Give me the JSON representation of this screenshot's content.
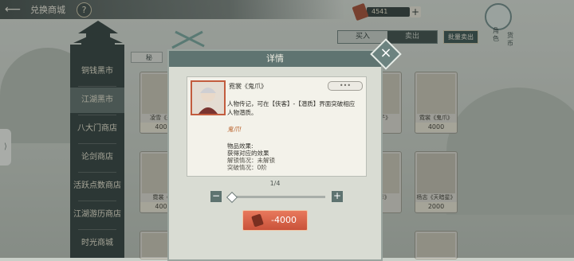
{
  "header": {
    "title": "兑换商城",
    "help_label": "?",
    "back_icon": "back-arrow-icon"
  },
  "currency": {
    "amount": "4541",
    "plus_label": "+",
    "icon": "token-icon"
  },
  "side_tab": {
    "line1": "角色",
    "line2": "货币"
  },
  "tabs": [
    {
      "label": "买入",
      "active": true
    },
    {
      "label": "卖出",
      "active": false
    }
  ],
  "batch_sell_label": "批量卖出",
  "filter_label": "秘",
  "sidebar": {
    "items": [
      {
        "label": "铜钱黑市",
        "active": false
      },
      {
        "label": "江湖黑市",
        "active": true
      },
      {
        "label": "八大门商店",
        "active": false
      },
      {
        "label": "论剑商店",
        "active": false
      },
      {
        "label": "活跃点数商店",
        "active": false
      },
      {
        "label": "江湖游历商店",
        "active": false
      },
      {
        "label": "时光商城",
        "active": false
      }
    ]
  },
  "cards": {
    "row1": [
      {
        "name": "凌雪《天",
        "price": "400"
      },
      {
        "name": "",
        "price": ""
      },
      {
        "name": "(摔)子》",
        "price": ""
      },
      {
        "name": "霓裳《鬼爪》",
        "price": "4000"
      }
    ],
    "row2": [
      {
        "name": "霓裳《",
        "price": "400"
      },
      {
        "name": "",
        "price": ""
      },
      {
        "name": "(刀影》",
        "price": ""
      },
      {
        "name": "杨志《天暗星》",
        "price": "2000"
      }
    ]
  },
  "dialog": {
    "title": "详情",
    "item_name": "霓裳《鬼爪》",
    "more_label": "•••",
    "description": "人物传记，可在【侠客】-【潜质】界面突破相应人物潜质。",
    "quote": "鬼爪!",
    "effect_title": "物品效果:",
    "effect_line": "获得对应的效果",
    "unlock_status": "解锁情况：未解锁",
    "breakthrough_status": "突破情况：0阶",
    "pager": "1/4",
    "minus_label": "−",
    "plus_label": "+",
    "price_label": "-4000",
    "quantity_fraction": 0.0
  }
}
